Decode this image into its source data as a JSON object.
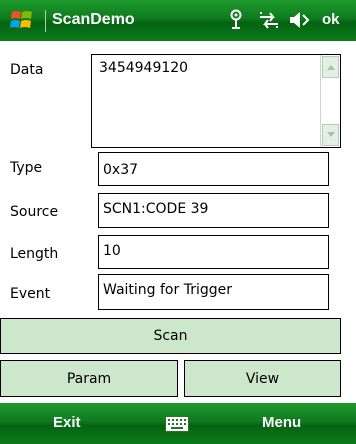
{
  "titlebar": {
    "title": "ScanDemo",
    "ok_label": "ok",
    "icons": [
      "windows-logo-icon",
      "signal-antenna-icon",
      "connectivity-arrows-icon",
      "volume-icon"
    ]
  },
  "fields": {
    "data": {
      "label": "Data",
      "value": "3454949120"
    },
    "type": {
      "label": "Type",
      "value": "0x37"
    },
    "source": {
      "label": "Source",
      "value": "SCN1:CODE 39"
    },
    "length": {
      "label": "Length",
      "value": "10"
    },
    "event": {
      "label": "Event",
      "value": "Waiting for Trigger"
    }
  },
  "buttons": {
    "scan": "Scan",
    "param": "Param",
    "view": "View"
  },
  "softkeys": {
    "left": "Exit",
    "right": "Menu",
    "center_icon": "keyboard-icon"
  },
  "colors": {
    "titlebar_green": "#0e7a1e",
    "button_fill": "#cde7cd"
  }
}
